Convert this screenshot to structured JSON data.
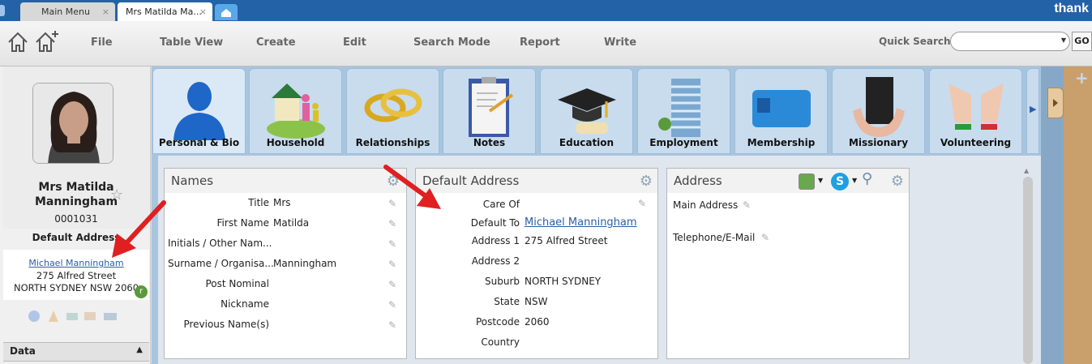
{
  "window_tabs": [
    {
      "label": "Main Menu",
      "close": "×"
    },
    {
      "label": "Mrs Matilda Ma...",
      "close": "×"
    }
  ],
  "brand": "thank",
  "toolbar": {
    "menus": [
      "File",
      "Table View",
      "Create",
      "Edit",
      "Search Mode",
      "Report",
      "Write"
    ],
    "quick_search_label": "Quick Search",
    "quick_search_value": "",
    "go_label": "GO"
  },
  "sidebar": {
    "name": "Mrs Matilda Manningham",
    "id": "0001031",
    "default_address_title": "Default Address",
    "address_link": "Michael Manningham",
    "address_line1": "275 Alfred Street",
    "address_line2": "NORTH SYDNEY NSW 2060",
    "data_section": "Data"
  },
  "nav_tabs": [
    {
      "label": "Personal & Bio",
      "icon": "person-icon"
    },
    {
      "label": "Household",
      "icon": "household-icon"
    },
    {
      "label": "Relationships",
      "icon": "rings-icon"
    },
    {
      "label": "Notes",
      "icon": "clipboard-icon"
    },
    {
      "label": "Education",
      "icon": "graduation-cap-icon"
    },
    {
      "label": "Employment",
      "icon": "office-building-icon"
    },
    {
      "label": "Membership",
      "icon": "membership-card-icon"
    },
    {
      "label": "Missionary",
      "icon": "bible-hands-icon"
    },
    {
      "label": "Volunteering",
      "icon": "raised-hands-icon"
    }
  ],
  "names_panel": {
    "title": "Names",
    "rows": [
      {
        "label": "Title",
        "value": "Mrs"
      },
      {
        "label": "First Name",
        "value": "Matilda"
      },
      {
        "label": "Initials / Other Nam...",
        "value": ""
      },
      {
        "label": "Surname / Organisa...",
        "value": "Manningham"
      },
      {
        "label": "Post Nominal",
        "value": ""
      },
      {
        "label": "Nickname",
        "value": ""
      },
      {
        "label": "Previous Name(s)",
        "value": ""
      }
    ]
  },
  "default_address_panel": {
    "title": "Default Address",
    "rows": [
      {
        "label": "Care Of",
        "value": ""
      },
      {
        "label": "Default To",
        "value": "Michael Manningham"
      },
      {
        "label": "Address 1",
        "value": "275 Alfred Street"
      },
      {
        "label": "Address 2",
        "value": ""
      },
      {
        "label": "Suburb",
        "value": "NORTH SYDNEY"
      },
      {
        "label": "State",
        "value": "NSW"
      },
      {
        "label": "Postcode",
        "value": "2060"
      },
      {
        "label": "Country",
        "value": ""
      }
    ]
  },
  "address_panel": {
    "title": "Address",
    "main_address": "Main Address",
    "telephone": "Telephone/E-Mail"
  },
  "colors": {
    "titlebar": "#2462a8",
    "link": "#2a5fa8",
    "arrow": "#e02020",
    "panel_bg": "#a7c5df"
  }
}
